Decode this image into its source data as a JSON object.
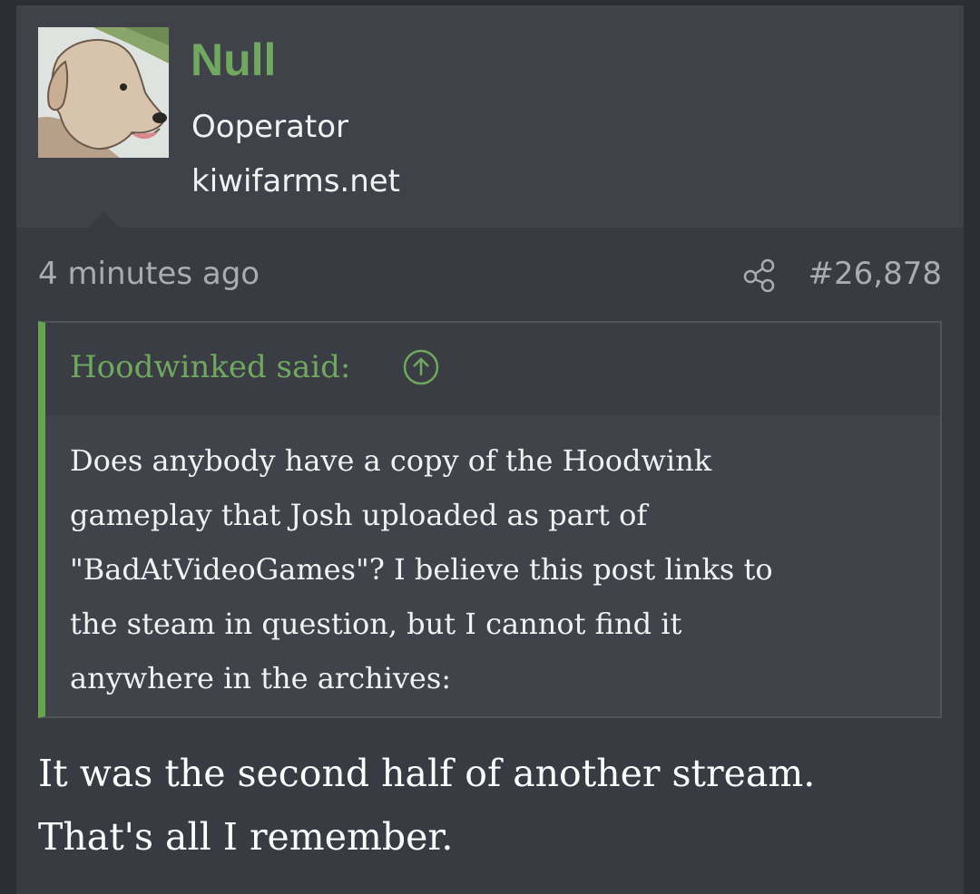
{
  "user": {
    "name": "Null",
    "title": "Ooperator",
    "site": "kiwifarms.net",
    "avatar_icon": "dog-avatar-icon"
  },
  "post": {
    "time": "4 minutes ago",
    "number": "#26,878",
    "share_icon": "share-icon"
  },
  "quote": {
    "author_label": "Hoodwinked said:",
    "jump_icon": "arrow-up-circle-icon",
    "lines": [
      "Does anybody have a copy of the Hoodwink",
      "gameplay that Josh uploaded as part of",
      "\"BadAtVideoGames\"? I believe this post links to",
      "the steam in question, but I cannot find it",
      "anywhere in the archives:"
    ]
  },
  "reply": {
    "lines": [
      "It was the second half of another stream.",
      "That's all I remember."
    ]
  },
  "colors": {
    "background": "#2b2e33",
    "post_bg": "#383b42",
    "header_bg": "#3f4249",
    "accent_green": "#6fa85e",
    "quote_border": "#67a44f",
    "muted_text": "#a9acb1",
    "text": "#f2f2f2"
  }
}
